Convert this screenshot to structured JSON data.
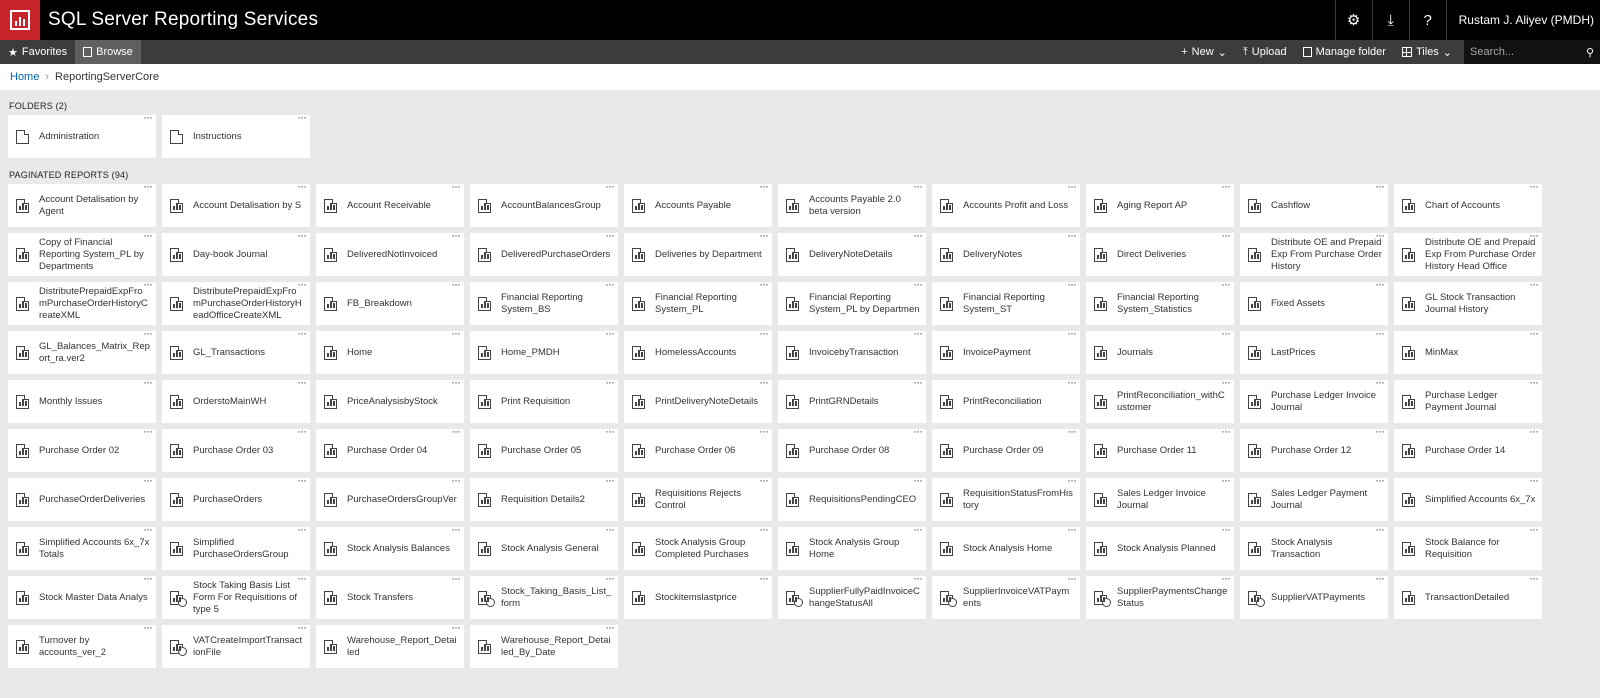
{
  "app": {
    "title": "SQL Server Reporting Services",
    "user": "Rustam J. Aliyev (PMDH)",
    "accent": "#c8242b"
  },
  "topbar": {
    "icons": [
      "gear-icon",
      "download-icon",
      "help-icon"
    ],
    "settings_glyph": "⚙",
    "download_glyph": "⤓",
    "help_glyph": "?"
  },
  "nav": {
    "favorites": "Favorites",
    "browse": "Browse",
    "new": "New",
    "upload": "Upload",
    "manage_folder": "Manage folder",
    "tiles": "Tiles",
    "search_placeholder": "Search..."
  },
  "breadcrumb": {
    "home": "Home",
    "current": "ReportingServerCore"
  },
  "folders": {
    "title": "FOLDERS (2)",
    "items": [
      "Administration",
      "Instructions"
    ]
  },
  "reports": {
    "title": "PAGINATED REPORTS (94)",
    "items": [
      {
        "label": "Account Detalisation by Agent"
      },
      {
        "label": "Account Detalisation by S"
      },
      {
        "label": "Account Receivable"
      },
      {
        "label": "AccountBalancesGroup"
      },
      {
        "label": "Accounts Payable"
      },
      {
        "label": "Accounts Payable 2.0 beta version"
      },
      {
        "label": "Accounts Profit and Loss"
      },
      {
        "label": "Aging Report AP"
      },
      {
        "label": "Cashflow"
      },
      {
        "label": "Chart of Accounts"
      },
      {
        "label": "Copy of Financial Reporting System_PL by Departments"
      },
      {
        "label": "Day-book Journal"
      },
      {
        "label": "DeliveredNotInvoiced"
      },
      {
        "label": "DeliveredPurchaseOrders"
      },
      {
        "label": "Deliveries by Department"
      },
      {
        "label": "DeliveryNoteDetails"
      },
      {
        "label": "DeliveryNotes"
      },
      {
        "label": "Direct Deliveries"
      },
      {
        "label": "Distribute OE and Prepaid Exp From Purchase Order History"
      },
      {
        "label": "Distribute OE and Prepaid Exp From Purchase Order History Head Office"
      },
      {
        "label": "DistributePrepaidExpFromPurchaseOrderHistoryCreateXML"
      },
      {
        "label": "DistributePrepaidExpFromPurchaseOrderHistoryHeadOfficeCreateXML"
      },
      {
        "label": "FB_Breakdown"
      },
      {
        "label": "Financial Reporting System_BS"
      },
      {
        "label": "Financial Reporting System_PL"
      },
      {
        "label": "Financial Reporting System_PL by Departmen"
      },
      {
        "label": "Financial Reporting System_ST"
      },
      {
        "label": "Financial Reporting System_Statistics"
      },
      {
        "label": "Fixed Assets"
      },
      {
        "label": "GL Stock Transaction Journal History"
      },
      {
        "label": "GL_Balances_Matrix_Report_ra.ver2"
      },
      {
        "label": "GL_Transactions"
      },
      {
        "label": "Home"
      },
      {
        "label": "Home_PMDH"
      },
      {
        "label": "HomelessAccounts"
      },
      {
        "label": "InvoicebyTransaction"
      },
      {
        "label": "InvoicePayment"
      },
      {
        "label": "Journals"
      },
      {
        "label": "LastPrices"
      },
      {
        "label": "MinMax"
      },
      {
        "label": "Monthly Issues"
      },
      {
        "label": "OrderstoMainWH"
      },
      {
        "label": "PriceAnalysisbyStock"
      },
      {
        "label": "Print Requisition"
      },
      {
        "label": "PrintDeliveryNoteDetails"
      },
      {
        "label": "PrintGRNDetails"
      },
      {
        "label": "PrintReconciliation"
      },
      {
        "label": "PrintReconciliation_withCustomer"
      },
      {
        "label": "Purchase Ledger Invoice Journal"
      },
      {
        "label": "Purchase Ledger Payment Journal"
      },
      {
        "label": "Purchase Order 02"
      },
      {
        "label": "Purchase Order 03"
      },
      {
        "label": "Purchase Order 04"
      },
      {
        "label": "Purchase Order 05"
      },
      {
        "label": "Purchase Order 06"
      },
      {
        "label": "Purchase Order 08"
      },
      {
        "label": "Purchase Order 09"
      },
      {
        "label": "Purchase Order 11"
      },
      {
        "label": "Purchase Order 12"
      },
      {
        "label": "Purchase Order 14"
      },
      {
        "label": "PurchaseOrderDeliveries"
      },
      {
        "label": "PurchaseOrders"
      },
      {
        "label": "PurchaseOrdersGroupVer"
      },
      {
        "label": "Requisition Details2"
      },
      {
        "label": "Requisitions Rejects Control"
      },
      {
        "label": "RequisitionsPendingCEO"
      },
      {
        "label": "RequisitionStatusFromHistory"
      },
      {
        "label": "Sales Ledger Invoice Journal"
      },
      {
        "label": "Sales Ledger Payment Journal"
      },
      {
        "label": "Simplified Accounts 6x_7x"
      },
      {
        "label": "Simplified Accounts 6x_7x Totals"
      },
      {
        "label": "Simplified PurchaseOrdersGroup"
      },
      {
        "label": "Stock Analysis Balances"
      },
      {
        "label": "Stock Analysis General"
      },
      {
        "label": "Stock Analysis Group Completed Purchases"
      },
      {
        "label": "Stock Analysis Group Home"
      },
      {
        "label": "Stock Analysis Home"
      },
      {
        "label": "Stock Analysis Planned"
      },
      {
        "label": "Stock Analysis Transaction"
      },
      {
        "label": "Stock Balance for Requisition"
      },
      {
        "label": "Stock Master Data Analys"
      },
      {
        "label": "Stock Taking Basis List Form For Requisitions of type 5",
        "sub": true
      },
      {
        "label": "Stock Transfers"
      },
      {
        "label": "Stock_Taking_Basis_List_form",
        "sub": true
      },
      {
        "label": "Stockitemslastprice"
      },
      {
        "label": "SupplierFullyPaidInvoiceChangeStatusAll",
        "sub": true
      },
      {
        "label": "SupplierInvoiceVATPayments",
        "sub": true
      },
      {
        "label": "SupplierPaymentsChangeStatus",
        "sub": true
      },
      {
        "label": "SupplierVATPayments",
        "sub": true
      },
      {
        "label": "TransactionDetailed"
      },
      {
        "label": "Turnover by accounts_ver_2"
      },
      {
        "label": "VATCreateImportTransactionFile",
        "sub": true
      },
      {
        "label": "Warehouse_Report_Detailed"
      },
      {
        "label": "Warehouse_Report_Detailed_By_Date"
      }
    ]
  }
}
